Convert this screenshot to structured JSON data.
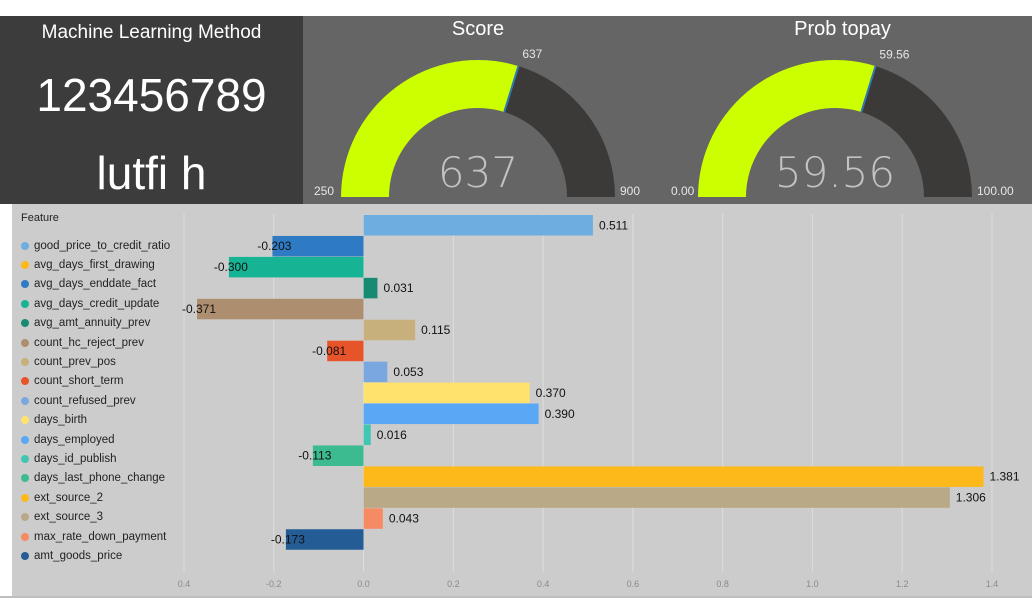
{
  "method": {
    "title": "Machine Learning Method",
    "id": "123456789",
    "name": "lutfi h"
  },
  "gauges": [
    {
      "title": "Score",
      "value": 637,
      "value_label": "637",
      "min": 250,
      "max": 900,
      "min_label": "250",
      "max_label": "900",
      "fill_color": "#ccff00",
      "track_color": "#3c3a38"
    },
    {
      "title": "Prob topay",
      "value": 59.56,
      "value_label": "59.56",
      "min": 0,
      "max": 100,
      "min_label": "0.00",
      "max_label": "100.00",
      "fill_color": "#ccff00",
      "track_color": "#3c3a38"
    }
  ],
  "chart_data": {
    "type": "bar",
    "orientation": "horizontal",
    "legend_title": "Feature",
    "legend_position": "left",
    "grid": true,
    "xlim": [
      -0.4,
      1.4
    ],
    "xticks": [
      -0.4,
      -0.2,
      0.0,
      0.2,
      0.4,
      0.6,
      0.8,
      1.0,
      1.2,
      1.4
    ],
    "xtick_labels": [
      "0.4",
      "-0.2",
      "0.0",
      "0.2",
      "0.4",
      "0.6",
      "0.8",
      "1.0",
      "1.2",
      "1.4"
    ],
    "categories": [
      "good_price_to_credit_ratio",
      "avg_days_first_drawing",
      "avg_days_enddate_fact",
      "avg_days_credit_update",
      "avg_amt_annuity_prev",
      "count_hc_reject_prev",
      "count_prev_pos",
      "count_short_term",
      "count_refused_prev",
      "days_birth",
      "days_employed",
      "days_id_publish",
      "days_last_phone_change",
      "ext_source_2",
      "ext_source_3",
      "max_rate_down_payment",
      "amt_goods_price"
    ],
    "values": [
      0.511,
      -0.203,
      -0.3,
      0.031,
      -0.371,
      0.115,
      -0.081,
      0.053,
      0.37,
      0.39,
      0.016,
      -0.113,
      1.381,
      1.306,
      0.043,
      -0.173
    ],
    "value_labels": [
      "0.511",
      "-0.203",
      "-0.300",
      "0.031",
      "-0.371",
      "0.115",
      "-0.081",
      "0.053",
      "0.370",
      "0.390",
      "0.016",
      "-0.113",
      "1.381",
      "1.306",
      "0.043",
      "-0.173"
    ],
    "bar_colors": [
      "#6eade0",
      "#2e7bc4",
      "#16b394",
      "#178a72",
      "#ad8f6f",
      "#c8b07d",
      "#e8542a",
      "#7ba7e0",
      "#ffe26e",
      "#5aa8f5",
      "#3fc7b1",
      "#3cba90",
      "#fdb91a",
      "#b9a986",
      "#f58a63",
      "#245d95"
    ],
    "legend_colors": [
      "#6eade0",
      "#fdb91a",
      "#2e7bc4",
      "#16b394",
      "#178a72",
      "#ad8f6f",
      "#c8b07d",
      "#e8542a",
      "#7ba7e0",
      "#ffe26e",
      "#5aa8f5",
      "#3fc7b1",
      "#3cba90",
      "#fdb91a",
      "#b9a986",
      "#f58a63",
      "#245d95"
    ]
  }
}
